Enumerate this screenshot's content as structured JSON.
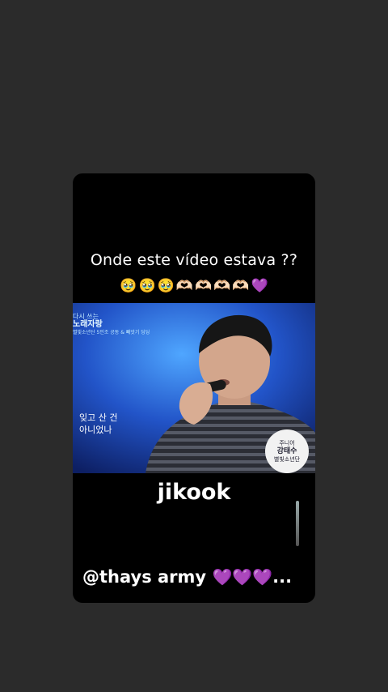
{
  "post": {
    "question": "Onde este vídeo estava ??",
    "emojis": [
      "🥹",
      "🥹",
      "🥹",
      "🫶🏻",
      "🫶🏻",
      "🫶🏻",
      "🫶🏻",
      "💜"
    ],
    "overlay_title": "jikook",
    "author": "@thays army",
    "author_hearts": "💜💜💜",
    "ellipsis": "..."
  },
  "video": {
    "logo_lines": [
      "다시 쓰는",
      "노래자랑",
      "별빛소년단 5인조 공동 & 빼앗기 딩딩"
    ],
    "subtitle_lines": [
      "잊고 산 건",
      "아니었나"
    ],
    "badge_lines": [
      "주니어",
      "강태수",
      "별빛소년단"
    ]
  },
  "colors": {
    "background": "#2b2b2b",
    "card": "#000000",
    "video_stage": "#1a3a9a"
  }
}
